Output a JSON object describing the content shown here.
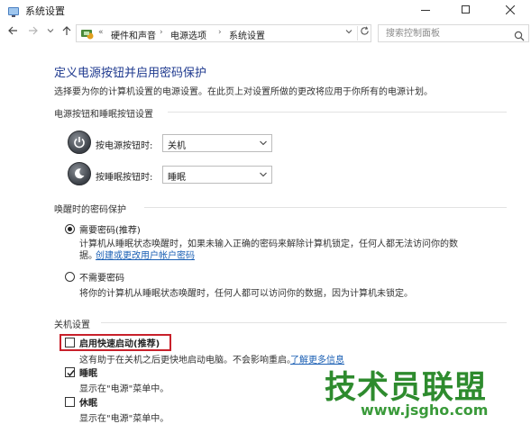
{
  "window": {
    "title": "系统设置"
  },
  "address_bar": {
    "recent_glyph": "«",
    "breadcrumbs": [
      "硬件和声音",
      "电源选项",
      "系统设置"
    ]
  },
  "search": {
    "placeholder": "搜索控制面板"
  },
  "main": {
    "heading": "定义电源按钮并启用密码保护",
    "description": "选择要为你的计算机设置的电源设置。在此页上对设置所做的更改将应用于你所有的电源计划。",
    "power_section": {
      "title": "电源按钮和睡眠按钮设置",
      "power_button_label": "按电源按钮时:",
      "power_button_value": "关机",
      "sleep_button_label": "按睡眠按钮时:",
      "sleep_button_value": "睡眠"
    },
    "wake_section": {
      "title": "唤醒时的密码保护",
      "option_require": "需要密码(推荐)",
      "option_require_desc": "计算机从睡眠状态唤醒时，如果未输入正确的密码来解除计算机锁定，任何人都无法访问你的数",
      "option_require_desc2": "据。",
      "option_require_link": "创建或更改用户帐户密码",
      "option_none": "不需要密码",
      "option_none_desc": "将你的计算机从睡眠状态唤醒时，任何人都可以访问你的数据，因为计算机未锁定。",
      "selected": "require"
    },
    "shutdown_section": {
      "title": "关机设置",
      "fast_startup_label": "启用快速启动(推荐)",
      "fast_startup_desc": "这有助于在关机之后更快地启动电脑。不会影响重启。",
      "fast_startup_link": "了解更多信息",
      "fast_startup_checked": false,
      "sleep_label": "睡眠",
      "sleep_desc": "显示在\"电源\"菜单中。",
      "sleep_checked": true,
      "hibernate_label": "休眠",
      "hibernate_desc": "显示在\"电源\"菜单中。",
      "hibernate_checked": false
    }
  },
  "watermark": {
    "text": "技术员联盟",
    "url": "www.jsgho.com"
  },
  "colors": {
    "heading": "#1f3a8f",
    "link": "#1a5fb4",
    "highlight_border": "#c8202a",
    "watermark": "#2e8b2e"
  }
}
